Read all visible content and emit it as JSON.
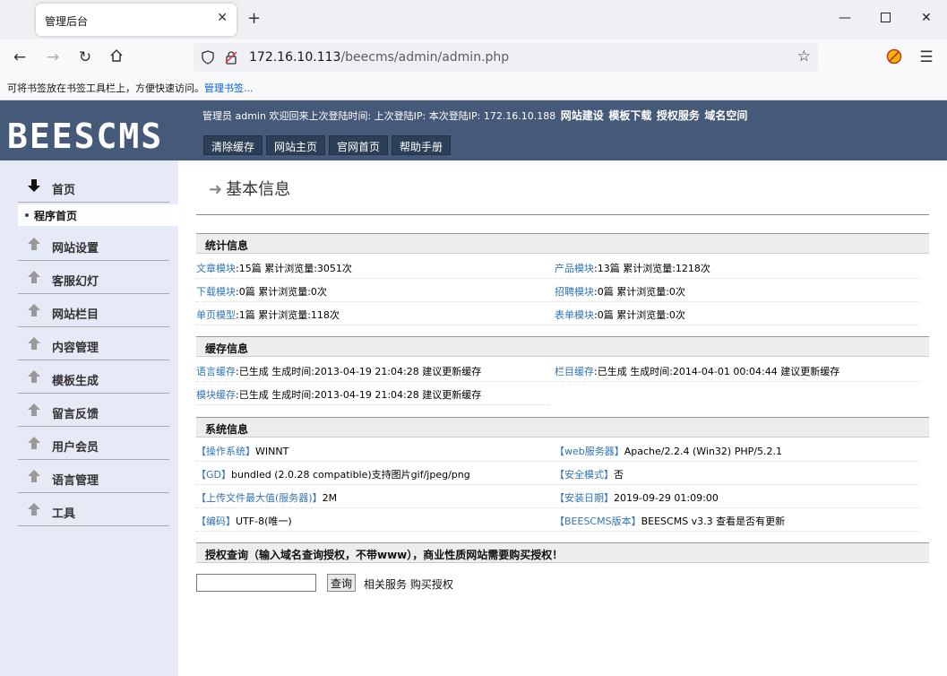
{
  "browser": {
    "tab_title": "管理后台",
    "tab_close": "✕",
    "new_tab": "+",
    "url_host": "172.16.10.113",
    "url_path": "/beecms/admin/admin.php",
    "bookmark_hint": "可将书签放在书签工具栏上，方便快速访问。",
    "bookmark_link": "管理书签..."
  },
  "header": {
    "logo": "BEESCMS",
    "info": "管理员 admin 欢迎回来上次登陆时间: 上次登陆IP: 本次登陆IP: 172.16.10.188",
    "links": [
      "网站建设",
      "模板下载",
      "授权服务",
      "域名空间"
    ],
    "buttons": [
      "清除缓存",
      "网站主页",
      "官网首页",
      "帮助手册"
    ]
  },
  "sidebar": {
    "home": "首页",
    "sub": "程序首页",
    "items": [
      "网站设置",
      "客服幻灯",
      "网站栏目",
      "内容管理",
      "模板生成",
      "留言反馈",
      "用户会员",
      "语言管理",
      "工具"
    ]
  },
  "main": {
    "title": "基本信息",
    "sections": {
      "stats": "统计信息",
      "cache": "缓存信息",
      "system": "系统信息",
      "auth": "授权查询（输入域名查询授权，不带www），商业性质网站需要购买授权！"
    },
    "stats": [
      {
        "link": "文章模块",
        "text": ":15篇  累计浏览量:3051次"
      },
      {
        "link": "产品模块",
        "text": ":13篇  累计浏览量:1218次"
      },
      {
        "link": "下载模块",
        "text": ":0篇  累计浏览量:0次"
      },
      {
        "link": "招聘模块",
        "text": ":0篇  累计浏览量:0次"
      },
      {
        "link": "单页模型",
        "text": ":1篇  累计浏览量:118次"
      },
      {
        "link": "表单模块",
        "text": ":0篇  累计浏览量:0次"
      }
    ],
    "cache": [
      {
        "link": "语言缓存",
        "text": ":已生成    生成时间:2013-04-19 21:04:28  建议更新缓存"
      },
      {
        "link": "栏目缓存",
        "text": ":已生成    生成时间:2014-04-01 00:04:44  建议更新缓存"
      },
      {
        "link": "模块缓存",
        "text": ":已生成    生成时间:2013-04-19 21:04:28  建议更新缓存"
      }
    ],
    "system": [
      {
        "link": "【操作系统】",
        "text": "WINNT"
      },
      {
        "link": "【web服务器】",
        "text": "Apache/2.2.4 (Win32) PHP/5.2.1"
      },
      {
        "link": "【GD】",
        "text": "bundled (2.0.28 compatible)支持图片gif/jpeg/png"
      },
      {
        "link": "【安全模式】",
        "text": "否"
      },
      {
        "link": "【上传文件最大值(服务器)】",
        "text": "2M"
      },
      {
        "link": "【安装日期】",
        "text": "2019-09-29 01:09:00"
      },
      {
        "link": "【编码】",
        "text": "UTF-8(唯一)"
      },
      {
        "link": "【BEESCMS版本】",
        "text": "BEESCMS v3.3  查看是否有更新"
      }
    ],
    "query_button": "查询",
    "query_links": "相关服务  购买授权"
  }
}
